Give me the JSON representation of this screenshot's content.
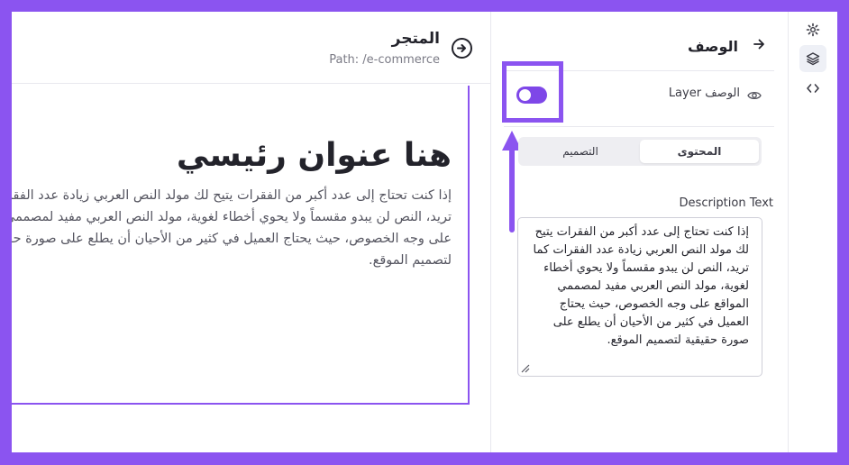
{
  "canvas": {
    "page_title": "المتجر",
    "page_path": "Path: /e-commerce",
    "back_icon": "arrow-circle-right-icon",
    "hero_title": "هنا عنوان رئيسي",
    "hero_text": "إذا كنت تحتاج إلى عدد أكبر من الفقرات يتيح لك مولد النص العربي زيادة عدد الفقرات كما تريد، النص لن يبدو مقسماً ولا يحوي أخطاء لغوية، مولد النص العربي مفيد لمصممي المواقع على وجه الخصوص، حيث يحتاج العميل في كثير من الأحيان أن يطلع على صورة حقيقية لتصميم الموقع."
  },
  "panel": {
    "title": "الوصف",
    "layer": {
      "label": "Layer الوصف",
      "toggle_on": true
    },
    "tabs": [
      {
        "label": "المحتوى",
        "active": true
      },
      {
        "label": "التصميم",
        "active": false
      }
    ],
    "description_label": "Description Text",
    "description_value": "إذا كنت تحتاج إلى عدد أكبر من الفقرات يتيح لك مولد النص العربي زيادة عدد الفقرات كما تريد، النص لن يبدو مقسماً ولا يحوي أخطاء لغوية، مولد النص العربي مفيد لمصممي المواقع على وجه الخصوص، حيث يحتاج العميل في كثير من الأحيان أن يطلع على صورة حقيقية لتصميم الموقع."
  },
  "rail": {
    "items": [
      {
        "icon": "gear-icon",
        "active": false
      },
      {
        "icon": "layers-icon",
        "active": true
      },
      {
        "icon": "code-icon",
        "active": false
      }
    ]
  },
  "colors": {
    "accent": "#8b54f0",
    "toggle": "#7e47e8",
    "text": "#23232b",
    "muted": "#7b7b86"
  }
}
